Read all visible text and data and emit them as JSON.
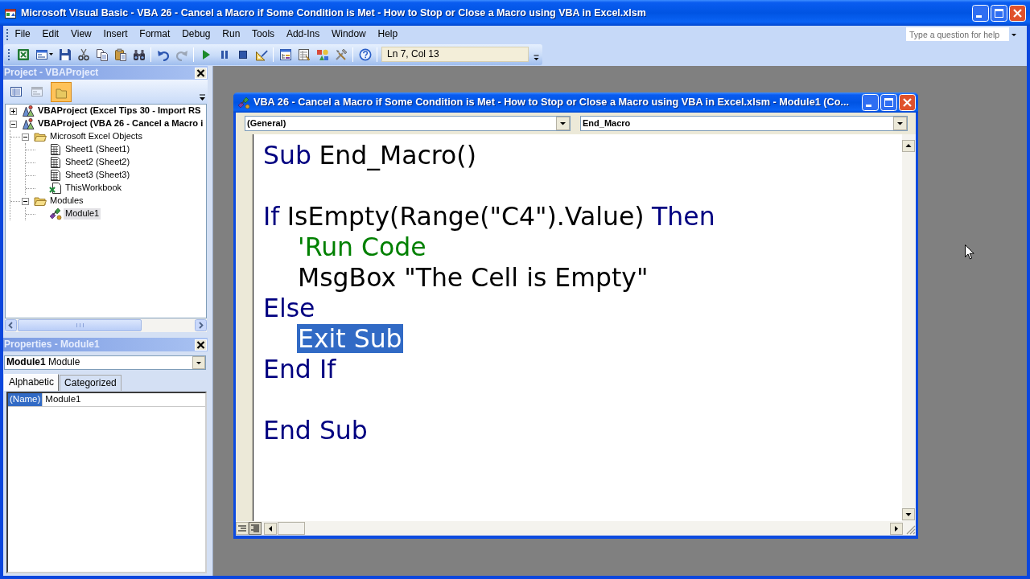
{
  "window": {
    "title": "Microsoft Visual Basic - VBA 26 - Cancel a Macro if Some Condition is Met - How to Stop or Close a Macro using VBA in Excel.xlsm"
  },
  "menu": [
    "File",
    "Edit",
    "View",
    "Insert",
    "Format",
    "Debug",
    "Run",
    "Tools",
    "Add-Ins",
    "Window",
    "Help"
  ],
  "help_box": {
    "placeholder": "Type a question for help"
  },
  "toolbar": {
    "buttons": [
      {
        "disabled": false
      },
      {
        "disabled": false
      },
      {
        "disabled": false
      },
      {
        "disabled": false
      },
      {
        "disabled": false
      },
      {
        "disabled": false
      },
      {
        "disabled": false
      },
      {
        "disabled": false
      },
      {
        "disabled": true
      },
      {
        "disabled": false
      },
      {
        "disabled": false
      },
      {
        "disabled": false
      },
      {
        "disabled": false
      },
      {
        "disabled": false
      },
      {
        "disabled": false
      },
      {
        "disabled": false
      },
      {
        "disabled": false
      },
      {
        "disabled": false
      }
    ],
    "position": "Ln 7, Col 13"
  },
  "project": {
    "title": "Project - VBAProject",
    "buttons": [
      {
        "disabled": false,
        "on": false
      },
      {
        "disabled": true,
        "on": false
      },
      {
        "disabled": false,
        "on": true
      }
    ],
    "tree": [
      {
        "label": "VBAProject (Excel Tips 30 - Import RS",
        "kind": "project",
        "expanded": false,
        "selected": false
      },
      {
        "label": "VBAProject (VBA 26 - Cancel a Macro i",
        "kind": "project",
        "expanded": true,
        "selected": false,
        "children": [
          {
            "label": "Microsoft Excel Objects",
            "kind": "folder",
            "expanded": true,
            "selected": false,
            "children": [
              {
                "label": "Sheet1 (Sheet1)",
                "kind": "sheet",
                "selected": false
              },
              {
                "label": "Sheet2 (Sheet2)",
                "kind": "sheet",
                "selected": false
              },
              {
                "label": "Sheet3 (Sheet3)",
                "kind": "sheet",
                "selected": false
              },
              {
                "label": "ThisWorkbook",
                "kind": "workbook",
                "selected": false
              }
            ]
          },
          {
            "label": "Modules",
            "kind": "folder",
            "expanded": true,
            "selected": false,
            "children": [
              {
                "label": "Module1",
                "kind": "module",
                "selected": true
              }
            ]
          }
        ]
      }
    ]
  },
  "properties": {
    "title": "Properties - Module1",
    "object": "**Module1** Module",
    "tabs": [
      {
        "label": "Alphabetic",
        "selected": true
      },
      {
        "label": "Categorized",
        "selected": false
      }
    ],
    "rows": [
      {
        "name": "(Name)",
        "value": "Module1",
        "selected": true
      }
    ]
  },
  "code_window": {
    "title": "VBA 26 - Cancel a Macro if Some Condition is Met - How to Stop or Close a Macro using VBA in Excel.xlsm - Module1 (Co...",
    "object_box": "(General)",
    "procedure_box": "End_Macro",
    "lines": [
      {
        "kind": "code",
        "selected": false,
        "segments": [
          {
            "kind": "keyword",
            "text": "Sub"
          },
          {
            "kind": "plain",
            "text": "End_Macro()"
          }
        ]
      },
      {
        "kind": "blank"
      },
      {
        "kind": "code",
        "selected": false,
        "segments": [
          {
            "kind": "keyword",
            "text": "If"
          },
          {
            "kind": "plain",
            "text": "IsEmpty(Range(\"C4\").Value)"
          },
          {
            "kind": "keyword",
            "text": "Then"
          }
        ],
        "children": [
          {
            "kind": "code",
            "selected": false,
            "segments": [
              {
                "kind": "comment",
                "text": "'Run Code"
              }
            ]
          },
          {
            "kind": "code",
            "selected": false,
            "segments": [
              {
                "kind": "plain",
                "text": "MsgBox \"The Cell is Empty\""
              }
            ]
          }
        ]
      },
      {
        "kind": "code",
        "selected": false,
        "segments": [
          {
            "kind": "keyword",
            "text": "Else"
          }
        ],
        "children": [
          {
            "kind": "code",
            "selected": true,
            "segments": [
              {
                "kind": "keyword",
                "text": "Exit Sub"
              }
            ]
          }
        ]
      },
      {
        "kind": "code",
        "selected": false,
        "segments": [
          {
            "kind": "keyword",
            "text": "End If"
          }
        ]
      },
      {
        "kind": "blank"
      },
      {
        "kind": "code",
        "selected": false,
        "segments": [
          {
            "kind": "keyword",
            "text": "End Sub"
          }
        ]
      }
    ]
  }
}
